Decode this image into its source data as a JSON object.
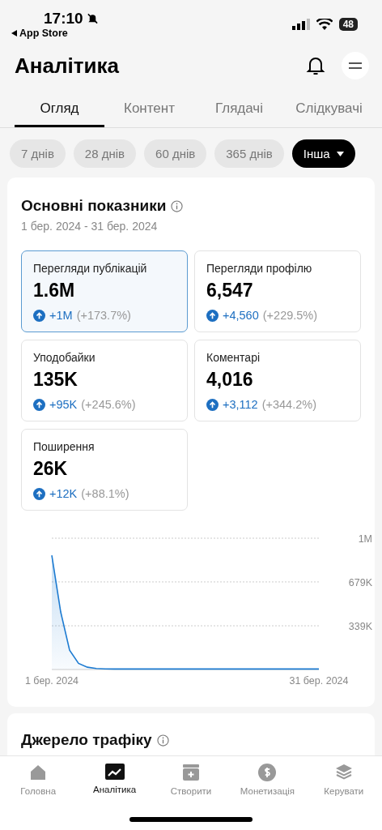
{
  "status_bar": {
    "time": "17:10",
    "back_label": "App Store",
    "battery": "48"
  },
  "header": {
    "title": "Аналітика"
  },
  "tabs": [
    {
      "label": "Огляд",
      "selected": true
    },
    {
      "label": "Контент",
      "selected": false
    },
    {
      "label": "Глядачі",
      "selected": false
    },
    {
      "label": "Слідкувачі",
      "selected": false
    }
  ],
  "periods": [
    {
      "label": "7 днів",
      "selected": false
    },
    {
      "label": "28 днів",
      "selected": false
    },
    {
      "label": "60 днів",
      "selected": false
    },
    {
      "label": "365 днів",
      "selected": false
    },
    {
      "label": "Інша",
      "selected": true,
      "kind": "dropdown"
    }
  ],
  "overview": {
    "title": "Основні показники",
    "date_range": "1 бер. 2024 - 31 бер. 2024",
    "metrics": [
      {
        "label": "Перегляди публікацій",
        "value": "1.6M",
        "change": "+1M",
        "percent": "(+173.7%)",
        "selected": true
      },
      {
        "label": "Перегляди профілю",
        "value": "6,547",
        "change": "+4,560",
        "percent": "(+229.5%)",
        "selected": false
      },
      {
        "label": "Уподобайки",
        "value": "135K",
        "change": "+95K",
        "percent": "(+245.6%)",
        "selected": false
      },
      {
        "label": "Коментарі",
        "value": "4,016",
        "change": "+3,112",
        "percent": "(+344.2%)",
        "selected": false
      },
      {
        "label": "Поширення",
        "value": "26K",
        "change": "+12K",
        "percent": "(+88.1%)",
        "selected": false
      }
    ],
    "chart_data": {
      "type": "area",
      "categories": [
        "1 бер. 2024",
        null,
        null,
        null,
        null,
        null,
        null,
        null,
        null,
        null,
        null,
        null,
        null,
        null,
        null,
        null,
        null,
        null,
        null,
        null,
        null,
        null,
        null,
        null,
        null,
        null,
        null,
        null,
        null,
        null,
        "31 бер. 2024"
      ],
      "series": [
        {
          "color": "#1d7bd1",
          "values": [
            885000,
            446000,
            150000,
            48000,
            18000,
            8000,
            5000,
            4000,
            4000,
            4000,
            4000,
            4000,
            4000,
            4000,
            4000,
            4000,
            4000,
            4000,
            4000,
            4000,
            4000,
            4000,
            4000,
            4000,
            4000,
            4000,
            4000,
            4000,
            5000,
            4000,
            4000
          ]
        }
      ],
      "ylim": [
        0,
        1018000
      ],
      "yticks": [
        {
          "value": 339000,
          "label": "339K"
        },
        {
          "value": 679000,
          "label": "679K"
        },
        {
          "value": 1018000,
          "label": "1M"
        }
      ]
    }
  },
  "traffic": {
    "title": "Джерело трафіку"
  },
  "bottom_nav": [
    {
      "label": "Головна",
      "selected": false
    },
    {
      "label": "Аналітика",
      "selected": true
    },
    {
      "label": "Створити",
      "selected": false
    },
    {
      "label": "Монетизація",
      "selected": false
    },
    {
      "label": "Керувати",
      "selected": false
    }
  ]
}
